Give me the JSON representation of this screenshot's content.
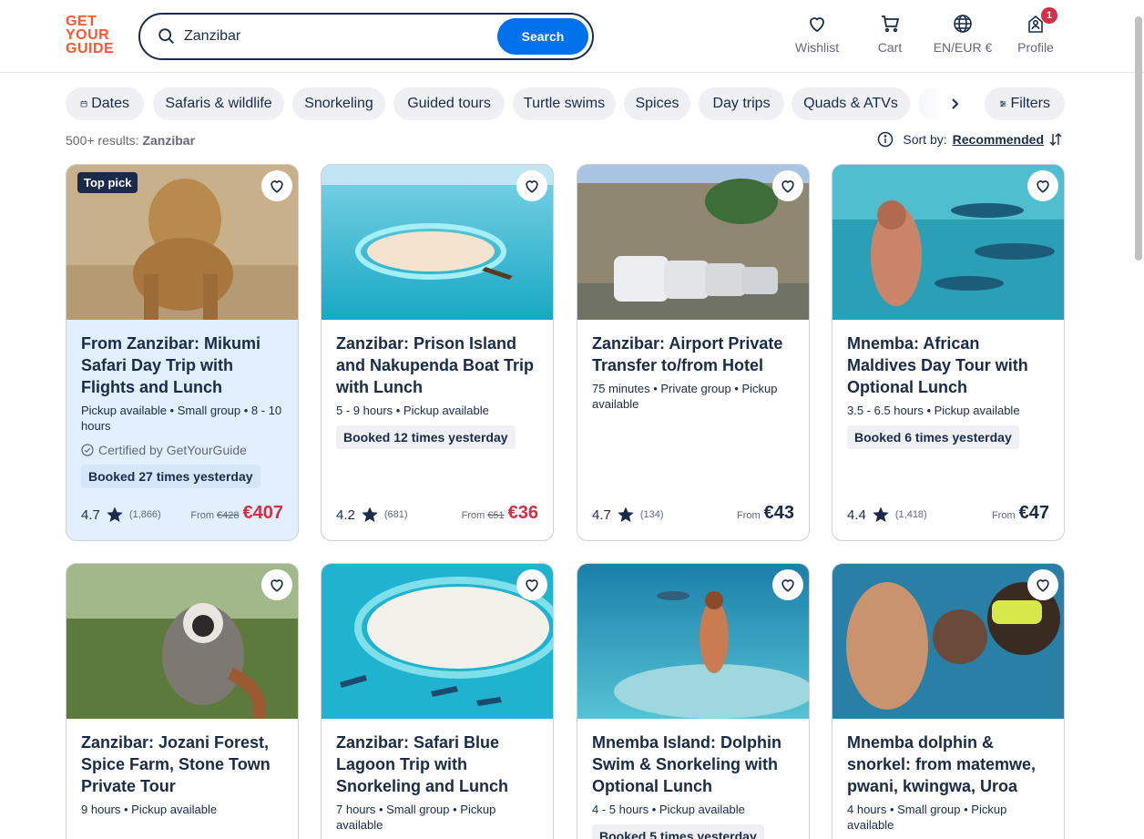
{
  "brand": {
    "logo_line1": "GET",
    "logo_line2": "YOUR",
    "logo_line3": "GUIDE",
    "color": "#ff5533"
  },
  "search": {
    "value": "Zanzibar",
    "button": "Search"
  },
  "nav": {
    "wishlist": "Wishlist",
    "cart": "Cart",
    "language": "EN/EUR €",
    "profile": "Profile",
    "profile_badge": "1"
  },
  "chips": [
    "Dates",
    "Safaris & wildlife",
    "Snorkeling",
    "Guided tours",
    "Turtle swims",
    "Spices",
    "Day trips",
    "Quads & ATVs"
  ],
  "filters_label": "Filters",
  "results": {
    "count": "500+ results:",
    "query": "Zanzibar"
  },
  "sort": {
    "label": "Sort by:",
    "value": "Recommended"
  },
  "cards": [
    {
      "title": "From Zanzibar: Mikumi Safari Day Trip with Flights and Lunch",
      "meta": "Pickup available • Small group • 8 - 10 hours",
      "certified": "Certified by GetYourGuide",
      "booked": "Booked 27 times yesterday",
      "rating": "4.7",
      "reviews": "(1,866)",
      "from": "From",
      "old_price": "€428",
      "price": "€407",
      "top_pick": "Top pick"
    },
    {
      "title": "Zanzibar: Prison Island and Nakupenda Boat Trip with Lunch",
      "meta": "5 - 9 hours • Pickup available",
      "booked": "Booked 12 times yesterday",
      "rating": "4.2",
      "reviews": "(681)",
      "from": "From",
      "old_price": "€51",
      "price": "€36"
    },
    {
      "title": "Zanzibar: Airport Private Transfer to/from Hotel",
      "meta": "75 minutes • Private group • Pickup available",
      "rating": "4.7",
      "reviews": "(134)",
      "from": "From",
      "price": "€43"
    },
    {
      "title": "Mnemba: African Maldives Day Tour with Optional Lunch",
      "meta": "3.5 - 6.5 hours • Pickup available",
      "booked": "Booked 6 times yesterday",
      "rating": "4.4",
      "reviews": "(1,418)",
      "from": "From",
      "price": "€47"
    },
    {
      "title": "Zanzibar: Jozani Forest, Spice Farm, Stone Town Private Tour",
      "meta": "9 hours • Pickup available"
    },
    {
      "title": "Zanzibar: Safari Blue Lagoon Trip with Snorkeling and Lunch",
      "meta": "7 hours • Small group • Pickup available"
    },
    {
      "title": "Mnemba Island: Dolphin Swim & Snorkeling with Optional Lunch",
      "meta": "4 - 5 hours • Pickup available",
      "booked": "Booked 5 times yesterday"
    },
    {
      "title": "Mnemba dolphin & snorkel: from matemwe, pwani, kwingwa, Uroa",
      "meta": "4 hours • Small group • Pickup available"
    }
  ],
  "colors": {
    "accent": "#0071eb",
    "sale": "#d42f43",
    "text": "#1a2b49",
    "chip_bg": "#eef0f3",
    "featured_bg": "#e1efff"
  }
}
